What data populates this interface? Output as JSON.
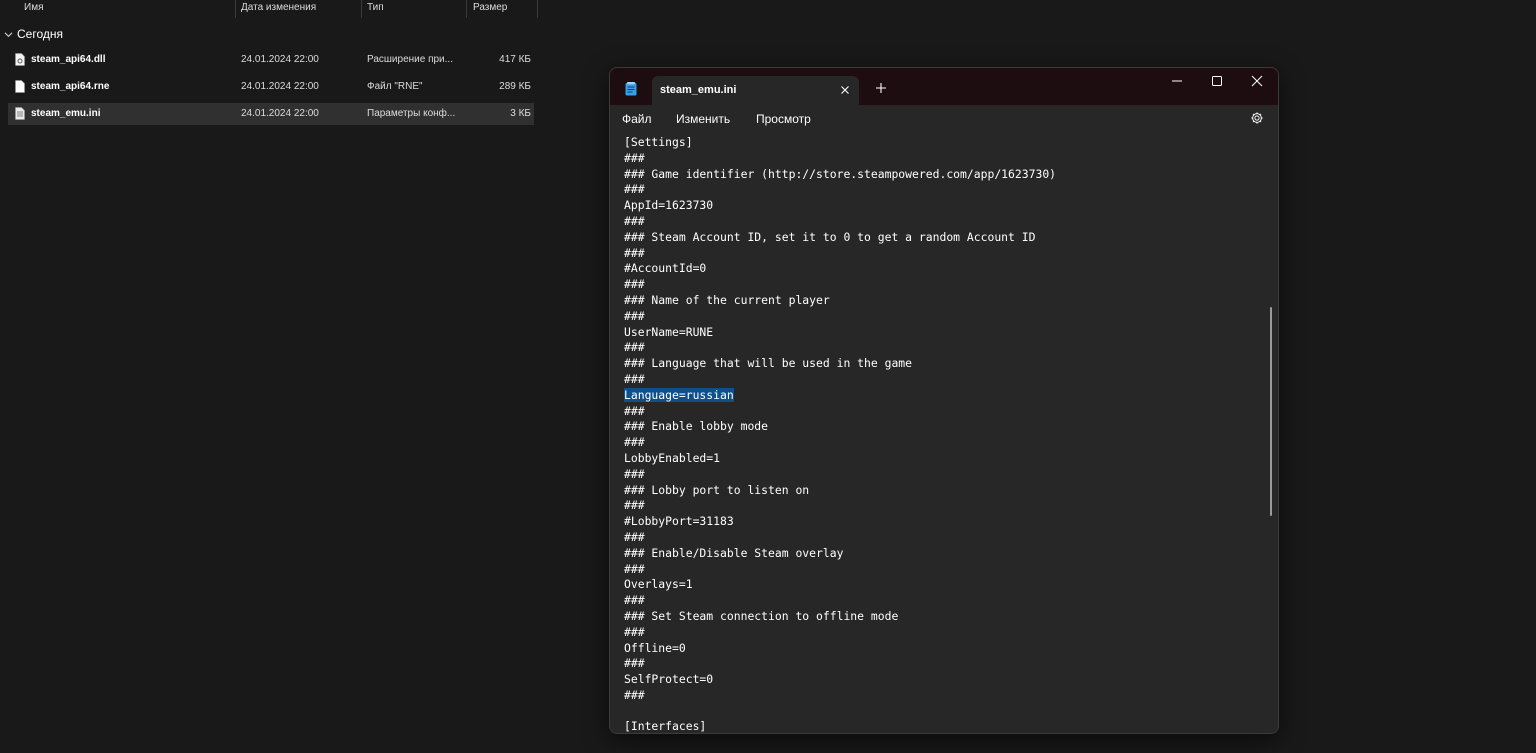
{
  "explorer": {
    "columns": {
      "name": "Имя",
      "date": "Дата изменения",
      "type": "Тип",
      "size": "Размер"
    },
    "group": "Сегодня",
    "files": [
      {
        "name": "steam_api64.dll",
        "date": "24.01.2024 22:00",
        "type": "Расширение при...",
        "size": "417 КБ",
        "icon": "dll-file-icon"
      },
      {
        "name": "steam_api64.rne",
        "date": "24.01.2024 22:00",
        "type": "Файл \"RNE\"",
        "size": "289 КБ",
        "icon": "file-icon"
      },
      {
        "name": "steam_emu.ini",
        "date": "24.01.2024 22:00",
        "type": "Параметры конф...",
        "size": "3 КБ",
        "icon": "ini-file-icon",
        "selected": true
      }
    ]
  },
  "notepad": {
    "tab_title": "steam_emu.ini",
    "menu": {
      "file": "Файл",
      "edit": "Изменить",
      "view": "Просмотр"
    },
    "highlight_color": "#0e4f8c",
    "lines": [
      "[Settings]",
      "###",
      "### Game identifier (http://store.steampowered.com/app/1623730)",
      "###",
      "AppId=1623730",
      "###",
      "### Steam Account ID, set it to 0 to get a random Account ID",
      "###",
      "#AccountId=0",
      "###",
      "### Name of the current player",
      "###",
      "UserName=RUNE",
      "###",
      "### Language that will be used in the game",
      "###",
      "Language=russian",
      "###",
      "### Enable lobby mode",
      "###",
      "LobbyEnabled=1",
      "###",
      "### Lobby port to listen on",
      "###",
      "#LobbyPort=31183",
      "###",
      "### Enable/Disable Steam overlay",
      "###",
      "Overlays=1",
      "###",
      "### Set Steam connection to offline mode",
      "###",
      "Offline=0",
      "###",
      "SelfProtect=0",
      "###",
      "",
      "[Interfaces]"
    ]
  }
}
